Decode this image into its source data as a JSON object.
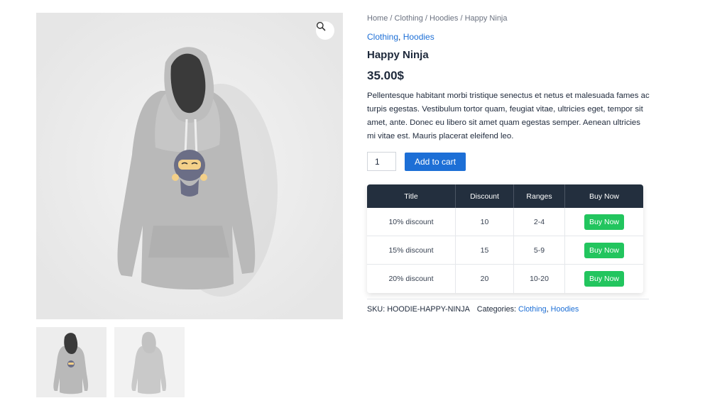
{
  "breadcrumb": {
    "items": [
      "Home",
      "Clothing",
      "Hoodies",
      "Happy Ninja"
    ],
    "separator": " / "
  },
  "categories": {
    "first": "Clothing",
    "comma": ", ",
    "second": "Hoodies"
  },
  "product": {
    "title": "Happy Ninja",
    "price": "35.00$",
    "description": "Pellentesque habitant morbi tristique senectus et netus et malesuada fames ac turpis egestas. Vestibulum tortor quam, feugiat vitae, ultricies eget, tempor sit amet, ante. Donec eu libero sit amet quam egestas semper. Aenean ultricies mi vitae est. Mauris placerat eleifend leo.",
    "quantity": "1",
    "add_to_cart_label": "Add to cart"
  },
  "gallery": {
    "zoom_icon": "magnifier-icon",
    "thumbnails": [
      "hoodie-front-thumbnail",
      "hoodie-back-thumbnail"
    ]
  },
  "discount_table": {
    "headers": [
      "Title",
      "Discount",
      "Ranges",
      "Buy Now"
    ],
    "rows": [
      {
        "title": "10% discount",
        "discount": "10",
        "range": "2-4",
        "button": "Buy Now"
      },
      {
        "title": "15% discount",
        "discount": "15",
        "range": "5-9",
        "button": "Buy Now"
      },
      {
        "title": "20% discount",
        "discount": "20",
        "range": "10-20",
        "button": "Buy Now"
      }
    ]
  },
  "meta": {
    "sku_label": "SKU: ",
    "sku_value": "HOODIE-HAPPY-NINJA",
    "categories_label": "Categories: ",
    "categories": [
      "Clothing",
      "Hoodies"
    ]
  },
  "colors": {
    "link": "#1d6fd6",
    "table_header": "#232f3e",
    "buy_button": "#22c55e",
    "text": "#1e293b"
  }
}
